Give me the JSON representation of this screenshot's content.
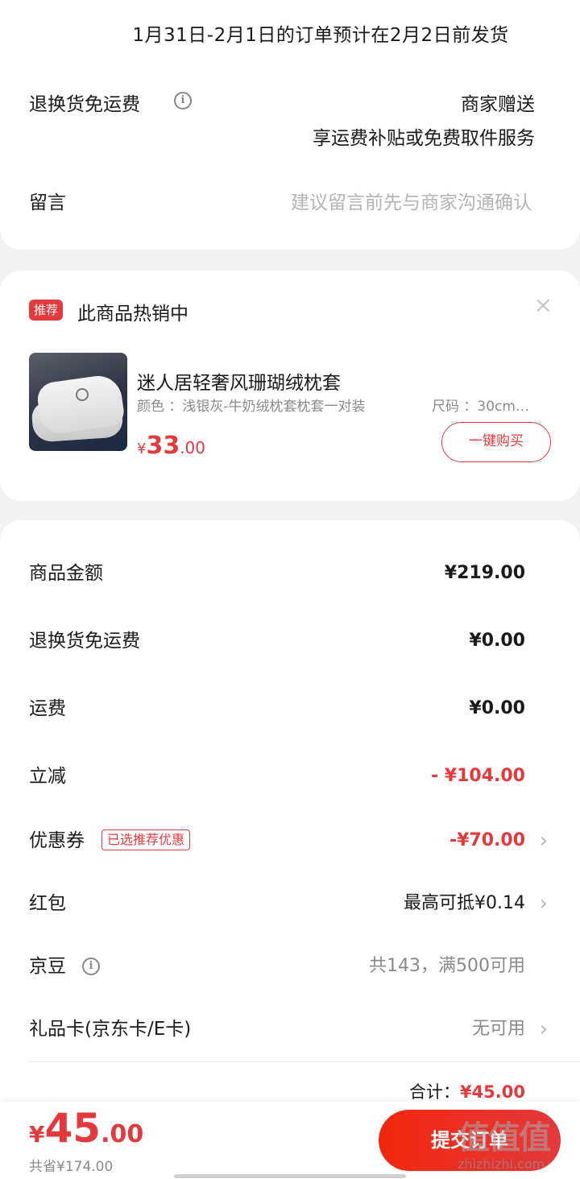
{
  "shipping_note": "1月31日-2月1日的订单预计在2月2日前发货",
  "return_shipping": {
    "label": "退换货免运费",
    "value_line1": "商家赠送",
    "value_line2": "享运费补贴或免费取件服务"
  },
  "message": {
    "label": "留言",
    "placeholder": "建议留言前先与商家沟通确认"
  },
  "recommend": {
    "tag": "推荐",
    "title": "此商品热销中",
    "close": "×",
    "product": {
      "name": "迷人居轻奢风珊瑚绒枕套",
      "spec_color": "颜色 ：浅银灰-牛奶绒枕套枕套一对装",
      "spec_size": "尺码 ：30cm…",
      "price_symbol": "¥",
      "price_int": "33",
      "price_dec": ".00",
      "buy_label": "一键购买"
    }
  },
  "summary": {
    "goods_amount": {
      "label": "商品金额",
      "value": "¥219.00"
    },
    "return_fee": {
      "label": "退换货免运费",
      "value": "¥0.00"
    },
    "freight": {
      "label": "运费",
      "value": "¥0.00"
    },
    "discount": {
      "label": "立减",
      "value": "- ¥104.00"
    },
    "coupon": {
      "label": "优惠券",
      "tag": "已选推荐优惠",
      "value": "-¥70.00"
    },
    "red_packet": {
      "label": "红包",
      "value": "最高可抵¥0.14"
    },
    "jd_beans": {
      "label": "京豆",
      "value": "共143，满500可用"
    },
    "gift_card": {
      "label": "礼品卡(京东卡/E卡)",
      "value": "无可用"
    },
    "total_label": "合计：",
    "total_value": "¥45.00"
  },
  "bottom_bar": {
    "price_symbol": "¥",
    "price_int": "45",
    "price_dec": ".00",
    "saved": "共省¥174.00",
    "submit_label": "提交订单"
  },
  "watermark": {
    "top": "值值值",
    "bottom": "zhizhizhi.com"
  },
  "colors": {
    "accent": "#e4393c",
    "background": "#f2f2f2",
    "muted_text": "#8a8a8a"
  }
}
